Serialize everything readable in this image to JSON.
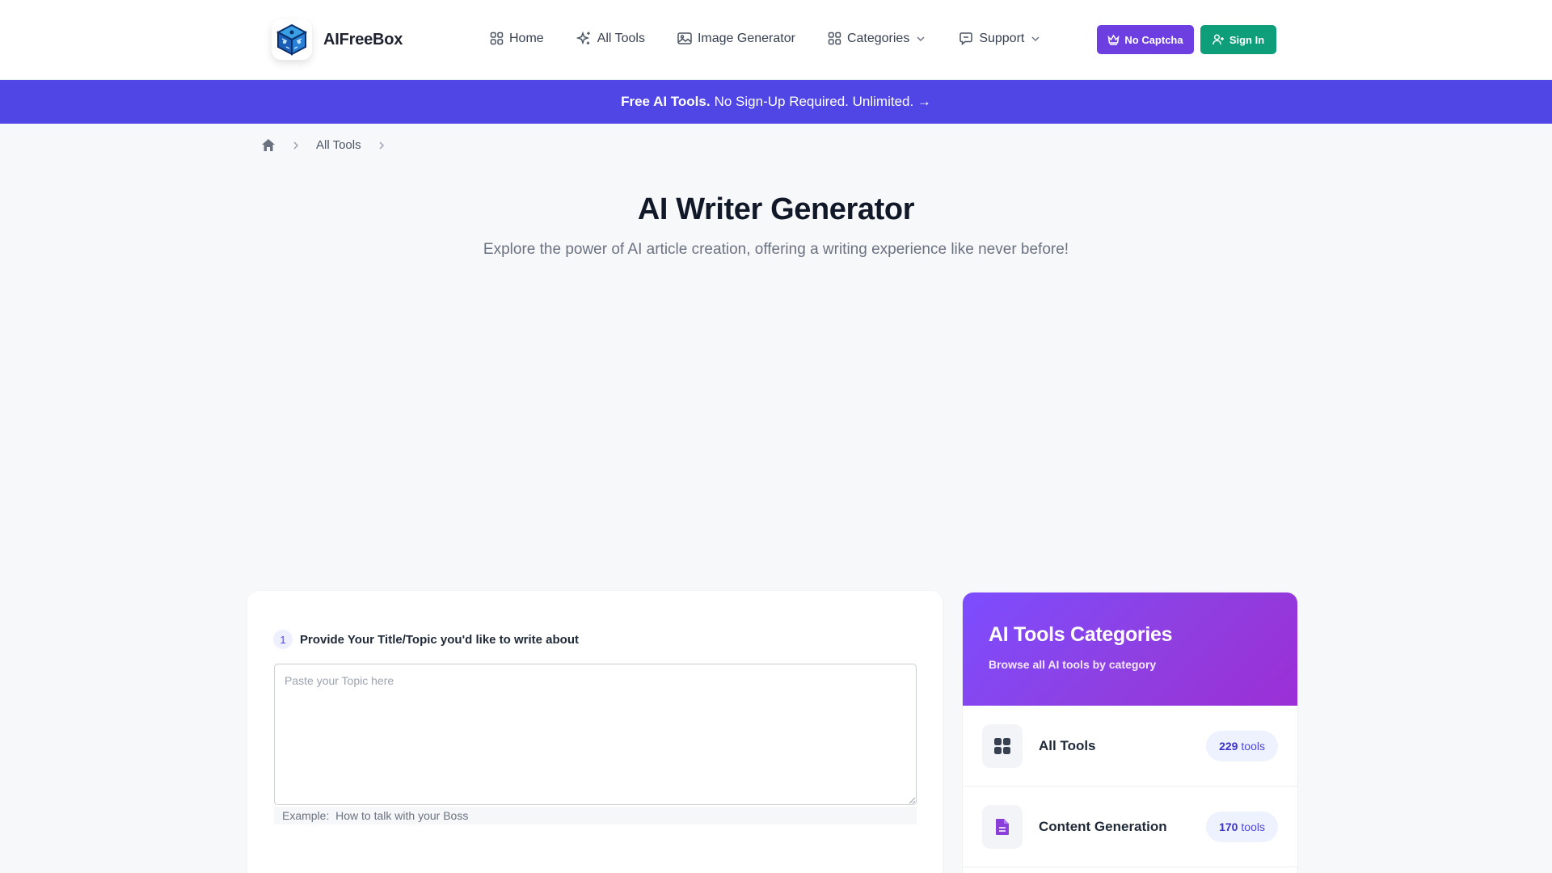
{
  "header": {
    "logo_text": "AIFreeBox",
    "nav": [
      {
        "label": "Home"
      },
      {
        "label": "All Tools"
      },
      {
        "label": "Image Generator"
      },
      {
        "label": "Categories"
      },
      {
        "label": "Support"
      }
    ],
    "no_captcha_label": "No Captcha",
    "sign_in_label": "Sign In"
  },
  "banner": {
    "bold": "Free AI Tools.",
    "text": "No Sign-Up Required. Unlimited. →"
  },
  "breadcrumb": {
    "item": "All Tools"
  },
  "hero": {
    "title": "AI Writer Generator",
    "subtitle": "Explore the power of AI article creation, offering a writing experience like never before!"
  },
  "form": {
    "step1_num": "1",
    "step1_label": "Provide Your Title/Topic you'd like to write about",
    "topic_placeholder": "Paste your Topic here",
    "topic_value": "",
    "example_prefix": "Example:",
    "example_text": "How to talk with your Boss"
  },
  "categories": {
    "title": "AI Tools Categories",
    "subtitle": "Browse all AI tools by category",
    "items": [
      {
        "label": "All Tools",
        "count": "229",
        "unit": "tools",
        "icon": "grid-icon"
      },
      {
        "label": "Content Generation",
        "count": "170",
        "unit": "tools",
        "icon": "document-icon"
      }
    ]
  },
  "colors": {
    "accent_purple": "#6d3ee0",
    "accent_green": "#0e9f7a",
    "banner_indigo": "#4f46e5"
  }
}
